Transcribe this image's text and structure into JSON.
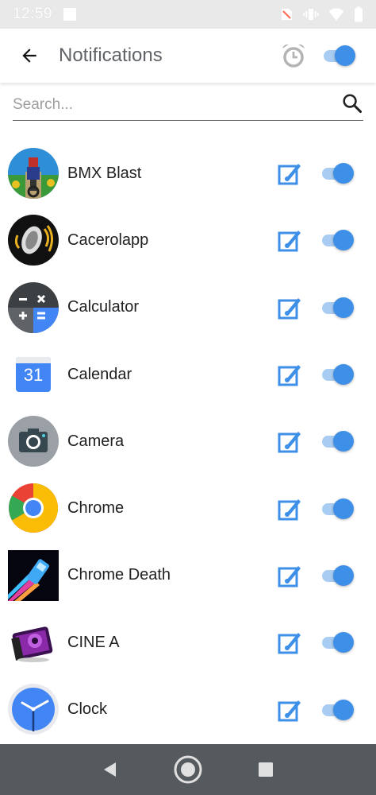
{
  "status_bar": {
    "time": "12:59"
  },
  "app_bar": {
    "title": "Notifications",
    "master_toggle_on": true
  },
  "search": {
    "placeholder": "Search..."
  },
  "colors": {
    "accent": "#3d8fe7",
    "accent_light": "#a9cdf2",
    "title_gray": "#5f6368",
    "nav_bar": "#555a5e"
  },
  "apps": [
    {
      "name": "BMX Blast",
      "icon": "bmx-blast-icon",
      "enabled": true
    },
    {
      "name": "Cacerolapp",
      "icon": "cacerolapp-icon",
      "enabled": true
    },
    {
      "name": "Calculator",
      "icon": "calculator-icon",
      "enabled": true
    },
    {
      "name": "Calendar",
      "icon": "calendar-icon",
      "enabled": true
    },
    {
      "name": "Camera",
      "icon": "camera-icon",
      "enabled": true
    },
    {
      "name": "Chrome",
      "icon": "chrome-icon",
      "enabled": true
    },
    {
      "name": "Chrome Death",
      "icon": "chrome-death-icon",
      "enabled": true
    },
    {
      "name": "CINE A",
      "icon": "cine-a-icon",
      "enabled": true
    },
    {
      "name": "Clock",
      "icon": "clock-icon",
      "enabled": true
    }
  ],
  "calendar_icon_text": "31"
}
